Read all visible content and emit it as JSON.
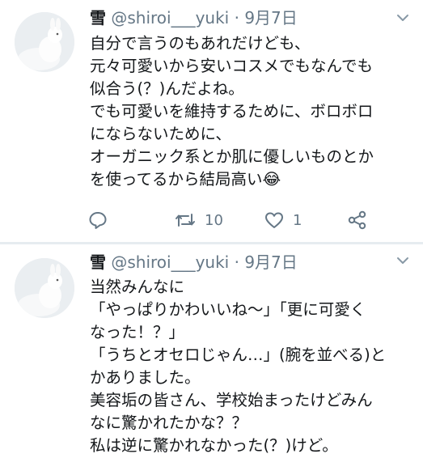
{
  "tweets": [
    {
      "name": "雪",
      "handle": "@shiroi___yuki",
      "separator": "·",
      "date": "9月7日",
      "lines": [
        "自分で言うのもあれだけども、",
        "元々可愛いから安いコスメでもなんでも",
        "似合う(？)んだよね。",
        "でも可愛いを維持するために、ボロボロ",
        "にならないために、",
        "オーガニック系とか肌に優しいものとか",
        "を使ってるから結局高い😂"
      ],
      "actions": {
        "reply_icon": "reply-icon",
        "retweet_icon": "retweet-icon",
        "retweet_count": "10",
        "like_icon": "heart-icon",
        "like_count": "1",
        "share_icon": "share-icon"
      }
    },
    {
      "name": "雪",
      "handle": "@shiroi___yuki",
      "separator": "·",
      "date": "9月7日",
      "lines": [
        "当然みんなに",
        "「やっぱりかわいいね〜」「更に可愛く",
        "なった！？」",
        "「うちとオセロじゃん…」(腕を並べる)と",
        "かありました。",
        "美容垢の皆さん、学校始まったけどみん",
        "なに驚かれたかな？？",
        "私は逆に驚かれなかった(？)けど。"
      ]
    }
  ],
  "colors": {
    "text": "#14171a",
    "secondary": "#657786",
    "divider": "#e6ecf0",
    "background": "#ffffff"
  }
}
